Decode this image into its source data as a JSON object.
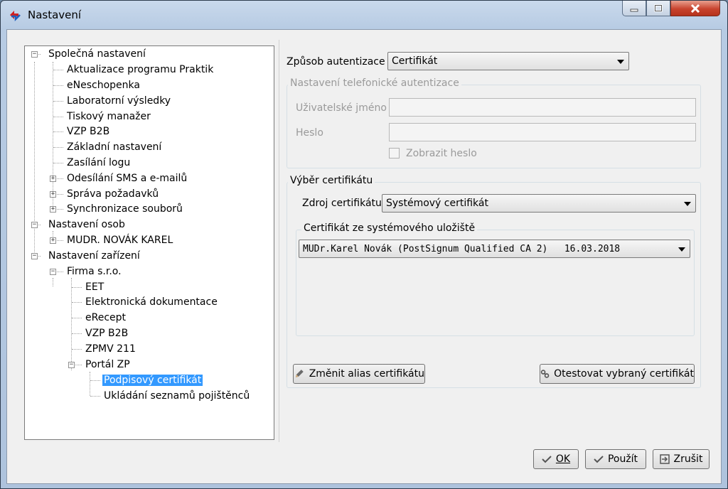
{
  "window": {
    "title": "Nastavení"
  },
  "tree": {
    "items": [
      {
        "label": "Společná nastavení",
        "level": 0,
        "expander": "minus"
      },
      {
        "label": "Aktualizace programu Praktik",
        "level": 1
      },
      {
        "label": "eNeschopenka",
        "level": 1
      },
      {
        "label": "Laboratorní výsledky",
        "level": 1
      },
      {
        "label": "Tiskový manažer",
        "level": 1
      },
      {
        "label": "VZP B2B",
        "level": 1
      },
      {
        "label": "Základní nastavení",
        "level": 1
      },
      {
        "label": "Zasílání logu",
        "level": 1
      },
      {
        "label": "Odesílání SMS a e-mailů",
        "level": 1,
        "expander": "plus"
      },
      {
        "label": "Správa požadavků",
        "level": 1,
        "expander": "plus"
      },
      {
        "label": "Synchronizace souborů",
        "level": 1,
        "expander": "plus"
      },
      {
        "label": "Nastavení osob",
        "level": 0,
        "expander": "minus"
      },
      {
        "label": "MUDR. NOVÁK KAREL",
        "level": 1,
        "expander": "plus"
      },
      {
        "label": "Nastavení zařízení",
        "level": 0,
        "expander": "minus"
      },
      {
        "label": "Firma s.r.o.",
        "level": 1,
        "expander": "minus"
      },
      {
        "label": "EET",
        "level": 2
      },
      {
        "label": "Elektronická dokumentace",
        "level": 2
      },
      {
        "label": "eRecept",
        "level": 2
      },
      {
        "label": "VZP B2B",
        "level": 2
      },
      {
        "label": "ZPMV 211",
        "level": 2
      },
      {
        "label": "Portál ZP",
        "level": 2,
        "expander": "minus"
      },
      {
        "label": "Podpisový certifikát",
        "level": 3,
        "selected": true
      },
      {
        "label": "Ukládání seznamů pojištěnců",
        "level": 3
      }
    ]
  },
  "auth": {
    "method_label": "Způsob autentizace",
    "method_value": "Certifikát"
  },
  "phone_auth": {
    "group_title": "Nastavení telefonické autentizace",
    "username_label": "Uživatelské jméno",
    "username_value": "",
    "password_label": "Heslo",
    "password_value": "",
    "show_password_label": "Zobrazit heslo"
  },
  "cert": {
    "group_title": "Výběr certifikátu",
    "source_label": "Zdroj certifikátu",
    "source_value": "Systémový certifikát",
    "store_group_title": "Certifikát ze systémového uložiště",
    "store_value": "MUDr.Karel Novák (PostSignum Qualified CA 2)   16.03.2018",
    "change_alias_label": "Změnit alias certifikátu",
    "test_label": "Otestovat vybraný certifikát"
  },
  "footer": {
    "ok_label": "OK",
    "apply_label": "Použít",
    "cancel_label": "Zrušit"
  },
  "colors": {
    "selection": "#3399ff",
    "close_button": "#c8442e"
  }
}
